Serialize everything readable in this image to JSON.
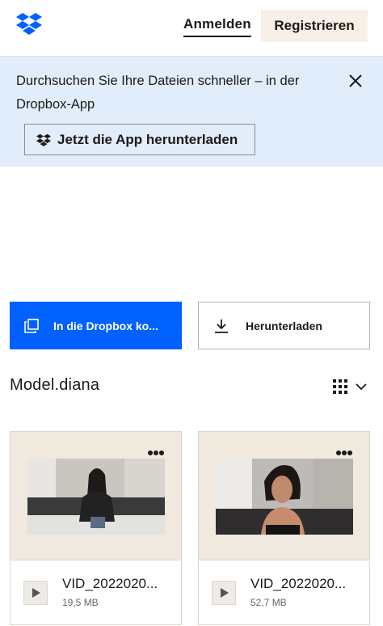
{
  "header": {
    "logo_icon": "dropbox-logo-icon",
    "signin_label": "Anmelden",
    "register_label": "Registrieren"
  },
  "banner": {
    "text": "Durchsuchen Sie Ihre Dateien schneller – in der Dropbox-App",
    "close_icon": "close-icon",
    "download_app_label": "Jetzt die App herunterladen"
  },
  "actions": {
    "save_to_dropbox_label": "In die Dropbox ko...",
    "download_label": "Herunterladen"
  },
  "folder": {
    "title": "Model.diana",
    "view_icon": "grid-view-icon"
  },
  "files": [
    {
      "name": "VID_2022020...",
      "size": "19,5 MB",
      "type_icon": "play-icon"
    },
    {
      "name": "VID_2022020...",
      "size": "52,7 MB",
      "type_icon": "play-icon"
    }
  ],
  "colors": {
    "accent": "#0061fe",
    "banner_bg": "#e1edfb",
    "register_bg": "#f7f0e6",
    "thumb_bg": "#efe9de"
  }
}
